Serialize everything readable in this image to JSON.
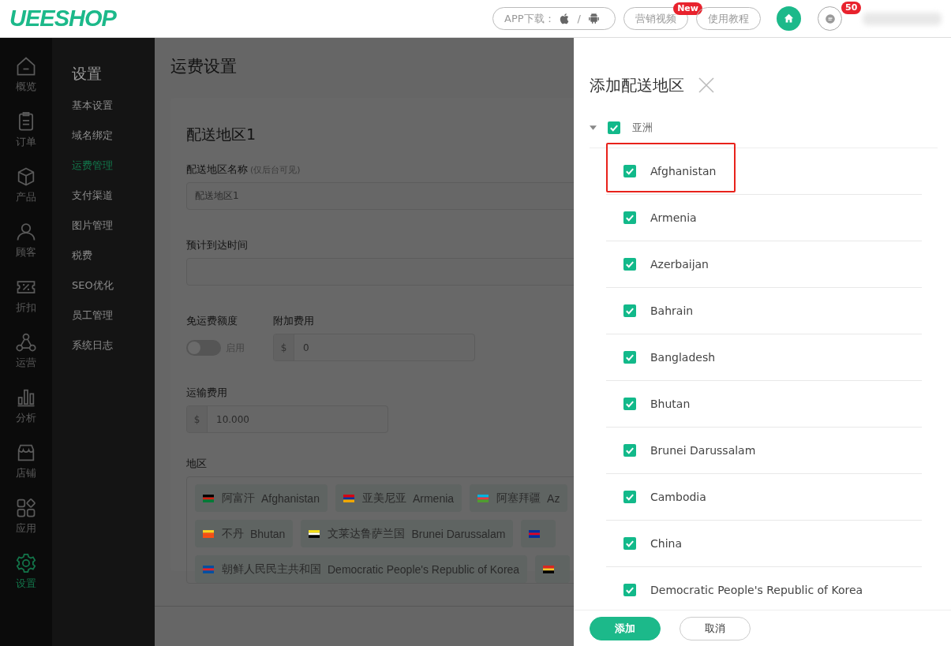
{
  "header": {
    "logo": "UEESHOP",
    "app_download": {
      "label": "APP下载：",
      "separator": "/"
    },
    "links": [
      {
        "label": "营销视频",
        "badge": "New"
      },
      {
        "label": "使用教程"
      }
    ],
    "messages_badge": "50"
  },
  "icon_sidebar": [
    {
      "label": "概览",
      "selected": false
    },
    {
      "label": "订单",
      "selected": false
    },
    {
      "label": "产品",
      "selected": false
    },
    {
      "label": "顾客",
      "selected": false
    },
    {
      "label": "折扣",
      "selected": false
    },
    {
      "label": "运营",
      "selected": false
    },
    {
      "label": "分析",
      "selected": false
    },
    {
      "label": "店铺",
      "selected": false
    },
    {
      "label": "应用",
      "selected": false
    },
    {
      "label": "设置",
      "selected": true
    }
  ],
  "settings_nav": {
    "title": "设置",
    "items": [
      {
        "label": "基本设置",
        "selected": false
      },
      {
        "label": "域名绑定",
        "selected": false
      },
      {
        "label": "运费管理",
        "selected": true
      },
      {
        "label": "支付渠道",
        "selected": false
      },
      {
        "label": "图片管理",
        "selected": false
      },
      {
        "label": "税费",
        "selected": false
      },
      {
        "label": "SEO优化",
        "selected": false
      },
      {
        "label": "员工管理",
        "selected": false
      },
      {
        "label": "系统日志",
        "selected": false
      }
    ]
  },
  "page": {
    "title": "运费设置",
    "zone": {
      "title": "配送地区1",
      "name_field": {
        "label": "配送地区名称",
        "note": "(仅后台可见)",
        "value": "配送地区1"
      },
      "eta_field": {
        "label": "预计到达时间"
      },
      "free_shipping": {
        "label": "免运费额度",
        "on": false,
        "toggle_label": "启用"
      },
      "extra_fee": {
        "label": "附加费用",
        "prefix": "$",
        "value": "0"
      },
      "shipping_fee": {
        "label": "运输费用",
        "prefix": "$",
        "value": "10.000"
      },
      "regions": {
        "label": "地区",
        "tags": [
          {
            "kind": "named",
            "cn": "阿富汗",
            "en": "Afghanistan"
          },
          {
            "kind": "named",
            "cn": "亚美尼亚",
            "en": "Armenia"
          },
          {
            "kind": "named",
            "cn": "阿塞拜疆",
            "en": "Az"
          },
          {
            "kind": "named",
            "cn": "不丹",
            "en": "Bhutan"
          },
          {
            "kind": "named",
            "cn": "文莱达鲁萨兰国",
            "en": "Brunei Darussalam"
          },
          {
            "kind": "flag"
          },
          {
            "kind": "named",
            "cn": "朝鲜人民民主共和国",
            "en": "Democratic People's Republic of Korea"
          },
          {
            "kind": "flag"
          }
        ]
      }
    }
  },
  "drawer": {
    "title": "添加配送地区",
    "region_tree": [
      {
        "label": "亚洲",
        "checked": true,
        "expanded": true,
        "children": [
          {
            "label": "Afghanistan",
            "checked": true,
            "highlighted": true
          },
          {
            "label": "Armenia",
            "checked": true,
            "highlighted": false
          },
          {
            "label": "Azerbaijan",
            "checked": true,
            "highlighted": false
          },
          {
            "label": "Bahrain",
            "checked": true,
            "highlighted": false
          },
          {
            "label": "Bangladesh",
            "checked": true,
            "highlighted": false
          },
          {
            "label": "Bhutan",
            "checked": true,
            "highlighted": false
          },
          {
            "label": "Brunei Darussalam",
            "checked": true,
            "highlighted": false
          },
          {
            "label": "Cambodia",
            "checked": true,
            "highlighted": false
          },
          {
            "label": "China",
            "checked": true,
            "highlighted": false
          },
          {
            "label": "Democratic People's Republic of Korea",
            "checked": true,
            "highlighted": false
          }
        ]
      }
    ],
    "buttons": [
      {
        "label": "添加",
        "kind": "primary"
      },
      {
        "label": "取消",
        "kind": "secondary"
      }
    ]
  }
}
